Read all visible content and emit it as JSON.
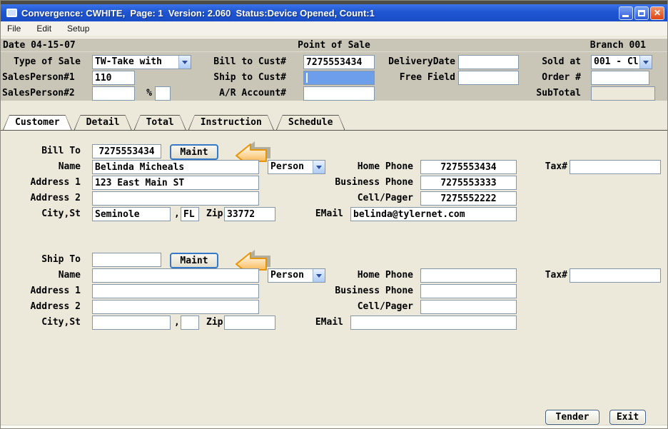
{
  "window": {
    "title": "Convergence: CWHITE,  Page: 1  Version: 2.060  Status:Device Opened, Count:1",
    "close_glyph": "✕"
  },
  "menu": {
    "items": [
      "File",
      "Edit",
      "Setup"
    ]
  },
  "pos_header": {
    "date": "Date 04-15-07",
    "title": "Point of Sale",
    "branch": "Branch 001"
  },
  "order": {
    "type_of_sale": {
      "label": "Type of Sale",
      "value": "TW-Take with"
    },
    "salesperson1": {
      "label": "SalesPerson#1",
      "value": "110"
    },
    "salesperson2": {
      "label": "SalesPerson#2",
      "value": ""
    },
    "percent": {
      "label": "%",
      "value": ""
    },
    "bill_to_cust": {
      "label": "Bill to Cust#",
      "value": "7275553434"
    },
    "ship_to_cust": {
      "label": "Ship to Cust#",
      "value": ""
    },
    "ar_account": {
      "label": "A/R Account#",
      "value": ""
    },
    "delivery_date": {
      "label": "DeliveryDate",
      "value": ""
    },
    "free_field": {
      "label": "Free Field",
      "value": ""
    },
    "sold_at": {
      "label": "Sold at",
      "value": "001 - Cl"
    },
    "order_num": {
      "label": "Order #",
      "value": ""
    },
    "subtotal": {
      "label": "SubTotal",
      "value": ""
    }
  },
  "tabs": [
    {
      "label": "Customer",
      "active": true
    },
    {
      "label": "Detail",
      "active": false
    },
    {
      "label": "Total",
      "active": false
    },
    {
      "label": "Instruction",
      "active": false
    },
    {
      "label": "Schedule",
      "active": false
    }
  ],
  "bill_to": {
    "label": "Bill To",
    "cust_value": "7275553434",
    "maint_label": "Maint",
    "name_label": "Name",
    "name_value": "Belinda Micheals",
    "person_value": "Person",
    "address1_label": "Address 1",
    "address1_value": "123 East Main ST",
    "address2_label": "Address 2",
    "address2_value": "",
    "city_label": "City,St",
    "city_value": "Seminole",
    "comma": ",",
    "state_value": "FL",
    "zip_label": "Zip",
    "zip_value": "33772",
    "home_phone_label": "Home Phone",
    "home_phone_value": "7275553434",
    "business_phone_label": "Business Phone",
    "business_phone_value": "7275553333",
    "cell_label": "Cell/Pager",
    "cell_value": "7275552222",
    "email_label": "EMail",
    "email_value": "belinda@tylernet.com",
    "tax_label": "Tax#",
    "tax_value": ""
  },
  "ship_to": {
    "label": "Ship To",
    "cust_value": "",
    "maint_label": "Maint",
    "name_label": "Name",
    "name_value": "",
    "person_value": "Person",
    "address1_label": "Address 1",
    "address1_value": "",
    "address2_label": "Address 2",
    "address2_value": "",
    "city_label": "City,St",
    "city_value": "",
    "comma": ",",
    "state_value": "",
    "zip_label": "Zip",
    "zip_value": "",
    "home_phone_label": "Home Phone",
    "home_phone_value": "",
    "business_phone_label": "Business Phone",
    "business_phone_value": "",
    "cell_label": "Cell/Pager",
    "cell_value": "",
    "email_label": "EMail",
    "email_value": "",
    "tax_label": "Tax#",
    "tax_value": ""
  },
  "footer": {
    "tender_label": "Tender",
    "exit_label": "Exit"
  },
  "colors": {
    "titlebar_blue": "#1f55d2",
    "band_gray": "#c9c6b8",
    "background_beige": "#ece9da",
    "focus_field_blue": "#6d9eeb",
    "maint_border_blue": "#3579c8",
    "arrow_orange": "#e8940a"
  }
}
